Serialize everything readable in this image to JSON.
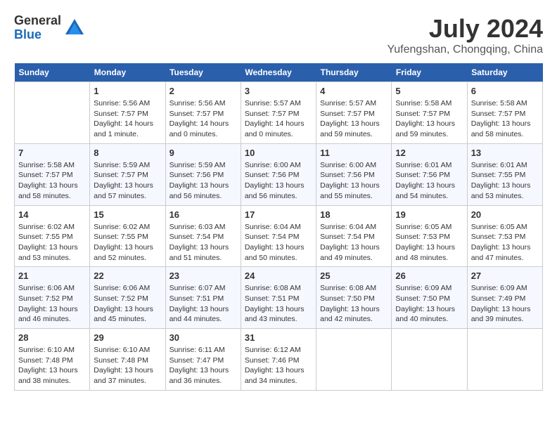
{
  "logo": {
    "general": "General",
    "blue": "Blue"
  },
  "title": {
    "month_year": "July 2024",
    "location": "Yufengshan, Chongqing, China"
  },
  "days_of_week": [
    "Sunday",
    "Monday",
    "Tuesday",
    "Wednesday",
    "Thursday",
    "Friday",
    "Saturday"
  ],
  "weeks": [
    [
      {
        "day": "",
        "info": ""
      },
      {
        "day": "1",
        "info": "Sunrise: 5:56 AM\nSunset: 7:57 PM\nDaylight: 14 hours\nand 1 minute."
      },
      {
        "day": "2",
        "info": "Sunrise: 5:56 AM\nSunset: 7:57 PM\nDaylight: 14 hours\nand 0 minutes."
      },
      {
        "day": "3",
        "info": "Sunrise: 5:57 AM\nSunset: 7:57 PM\nDaylight: 14 hours\nand 0 minutes."
      },
      {
        "day": "4",
        "info": "Sunrise: 5:57 AM\nSunset: 7:57 PM\nDaylight: 13 hours\nand 59 minutes."
      },
      {
        "day": "5",
        "info": "Sunrise: 5:58 AM\nSunset: 7:57 PM\nDaylight: 13 hours\nand 59 minutes."
      },
      {
        "day": "6",
        "info": "Sunrise: 5:58 AM\nSunset: 7:57 PM\nDaylight: 13 hours\nand 58 minutes."
      }
    ],
    [
      {
        "day": "7",
        "info": "Sunrise: 5:58 AM\nSunset: 7:57 PM\nDaylight: 13 hours\nand 58 minutes."
      },
      {
        "day": "8",
        "info": "Sunrise: 5:59 AM\nSunset: 7:57 PM\nDaylight: 13 hours\nand 57 minutes."
      },
      {
        "day": "9",
        "info": "Sunrise: 5:59 AM\nSunset: 7:56 PM\nDaylight: 13 hours\nand 56 minutes."
      },
      {
        "day": "10",
        "info": "Sunrise: 6:00 AM\nSunset: 7:56 PM\nDaylight: 13 hours\nand 56 minutes."
      },
      {
        "day": "11",
        "info": "Sunrise: 6:00 AM\nSunset: 7:56 PM\nDaylight: 13 hours\nand 55 minutes."
      },
      {
        "day": "12",
        "info": "Sunrise: 6:01 AM\nSunset: 7:56 PM\nDaylight: 13 hours\nand 54 minutes."
      },
      {
        "day": "13",
        "info": "Sunrise: 6:01 AM\nSunset: 7:55 PM\nDaylight: 13 hours\nand 53 minutes."
      }
    ],
    [
      {
        "day": "14",
        "info": "Sunrise: 6:02 AM\nSunset: 7:55 PM\nDaylight: 13 hours\nand 53 minutes."
      },
      {
        "day": "15",
        "info": "Sunrise: 6:02 AM\nSunset: 7:55 PM\nDaylight: 13 hours\nand 52 minutes."
      },
      {
        "day": "16",
        "info": "Sunrise: 6:03 AM\nSunset: 7:54 PM\nDaylight: 13 hours\nand 51 minutes."
      },
      {
        "day": "17",
        "info": "Sunrise: 6:04 AM\nSunset: 7:54 PM\nDaylight: 13 hours\nand 50 minutes."
      },
      {
        "day": "18",
        "info": "Sunrise: 6:04 AM\nSunset: 7:54 PM\nDaylight: 13 hours\nand 49 minutes."
      },
      {
        "day": "19",
        "info": "Sunrise: 6:05 AM\nSunset: 7:53 PM\nDaylight: 13 hours\nand 48 minutes."
      },
      {
        "day": "20",
        "info": "Sunrise: 6:05 AM\nSunset: 7:53 PM\nDaylight: 13 hours\nand 47 minutes."
      }
    ],
    [
      {
        "day": "21",
        "info": "Sunrise: 6:06 AM\nSunset: 7:52 PM\nDaylight: 13 hours\nand 46 minutes."
      },
      {
        "day": "22",
        "info": "Sunrise: 6:06 AM\nSunset: 7:52 PM\nDaylight: 13 hours\nand 45 minutes."
      },
      {
        "day": "23",
        "info": "Sunrise: 6:07 AM\nSunset: 7:51 PM\nDaylight: 13 hours\nand 44 minutes."
      },
      {
        "day": "24",
        "info": "Sunrise: 6:08 AM\nSunset: 7:51 PM\nDaylight: 13 hours\nand 43 minutes."
      },
      {
        "day": "25",
        "info": "Sunrise: 6:08 AM\nSunset: 7:50 PM\nDaylight: 13 hours\nand 42 minutes."
      },
      {
        "day": "26",
        "info": "Sunrise: 6:09 AM\nSunset: 7:50 PM\nDaylight: 13 hours\nand 40 minutes."
      },
      {
        "day": "27",
        "info": "Sunrise: 6:09 AM\nSunset: 7:49 PM\nDaylight: 13 hours\nand 39 minutes."
      }
    ],
    [
      {
        "day": "28",
        "info": "Sunrise: 6:10 AM\nSunset: 7:48 PM\nDaylight: 13 hours\nand 38 minutes."
      },
      {
        "day": "29",
        "info": "Sunrise: 6:10 AM\nSunset: 7:48 PM\nDaylight: 13 hours\nand 37 minutes."
      },
      {
        "day": "30",
        "info": "Sunrise: 6:11 AM\nSunset: 7:47 PM\nDaylight: 13 hours\nand 36 minutes."
      },
      {
        "day": "31",
        "info": "Sunrise: 6:12 AM\nSunset: 7:46 PM\nDaylight: 13 hours\nand 34 minutes."
      },
      {
        "day": "",
        "info": ""
      },
      {
        "day": "",
        "info": ""
      },
      {
        "day": "",
        "info": ""
      }
    ]
  ]
}
